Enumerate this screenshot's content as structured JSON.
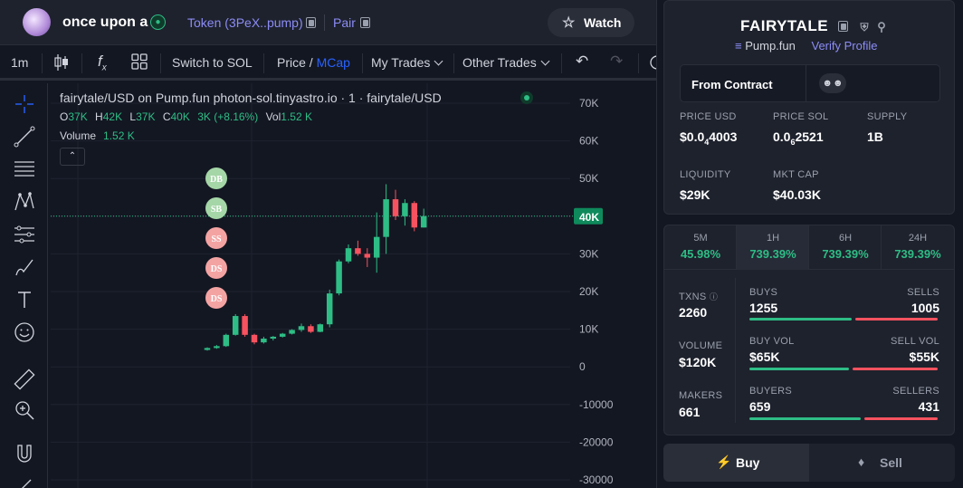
{
  "header": {
    "token_name": "once upon a",
    "token_link": "Token (3PeX..pump)",
    "pair_link": "Pair",
    "watch_label": "Watch"
  },
  "toolbar": {
    "interval": "1m",
    "switch_label": "Switch to SOL",
    "price_label": "Price",
    "slash": "/",
    "mcap_label": "MCap",
    "my_trades": "My Trades",
    "other_trades": "Other Trades"
  },
  "chart": {
    "legend_title": "fairytale/USD on Pump.fun photon-sol.tinyastro.io · 1 · fairytale/USD",
    "ohlc": {
      "o_label": "O",
      "o": "37K",
      "h_label": "H",
      "h": "42K",
      "l_label": "L",
      "l": "37K",
      "c_label": "C",
      "c": "40K",
      "change": "3K (+8.16%)",
      "vol_label": "Vol",
      "vol": "1.52 K"
    },
    "volume_label": "Volume",
    "volume_value": "1.52 K",
    "last_price_tag": "40K",
    "markers": [
      "DB",
      "SB",
      "SS",
      "DS",
      "DS"
    ],
    "y_ticks": [
      "70K",
      "60K",
      "50K",
      "40K",
      "30K",
      "20K",
      "10K",
      "0",
      "-10000",
      "-20000",
      "-30000"
    ]
  },
  "chart_data": {
    "type": "candlestick",
    "series": [
      {
        "name": "fairytale/USD",
        "candles": [
          {
            "o": 4500,
            "h": 5200,
            "l": 4300,
            "c": 5000
          },
          {
            "o": 5000,
            "h": 5800,
            "l": 4800,
            "c": 5500
          },
          {
            "o": 5500,
            "h": 8800,
            "l": 5300,
            "c": 8500
          },
          {
            "o": 8500,
            "h": 14000,
            "l": 8300,
            "c": 13500
          },
          {
            "o": 13500,
            "h": 14000,
            "l": 8000,
            "c": 8500
          },
          {
            "o": 8500,
            "h": 8800,
            "l": 6000,
            "c": 6500
          },
          {
            "o": 6500,
            "h": 8000,
            "l": 6200,
            "c": 7500
          },
          {
            "o": 7500,
            "h": 8200,
            "l": 7000,
            "c": 8000
          },
          {
            "o": 8000,
            "h": 9000,
            "l": 7800,
            "c": 8800
          },
          {
            "o": 8800,
            "h": 10000,
            "l": 8600,
            "c": 9800
          },
          {
            "o": 9800,
            "h": 11500,
            "l": 9300,
            "c": 10800
          },
          {
            "o": 10800,
            "h": 11300,
            "l": 9000,
            "c": 9300
          },
          {
            "o": 9300,
            "h": 11500,
            "l": 9200,
            "c": 11300
          },
          {
            "o": 11300,
            "h": 20500,
            "l": 10500,
            "c": 19500
          },
          {
            "o": 19500,
            "h": 28500,
            "l": 19000,
            "c": 28000
          },
          {
            "o": 28000,
            "h": 32500,
            "l": 27500,
            "c": 31500
          },
          {
            "o": 31500,
            "h": 33500,
            "l": 29500,
            "c": 30000
          },
          {
            "o": 30000,
            "h": 31500,
            "l": 26500,
            "c": 29000
          },
          {
            "o": 29000,
            "h": 41000,
            "l": 25000,
            "c": 34500
          },
          {
            "o": 34500,
            "h": 48500,
            "l": 30000,
            "c": 44500
          },
          {
            "o": 44500,
            "h": 47000,
            "l": 39000,
            "c": 40000
          },
          {
            "o": 40000,
            "h": 44500,
            "l": 37500,
            "c": 43500
          },
          {
            "o": 43500,
            "h": 44000,
            "l": 36000,
            "c": 37000
          },
          {
            "o": 37000,
            "h": 42000,
            "l": 37000,
            "c": 40000
          }
        ]
      }
    ],
    "ylim": [
      -30000,
      70000
    ],
    "grid": true,
    "last_price": 40000
  },
  "panel": {
    "title": "FAIRYTALE",
    "platform": "Pump.fun",
    "verify": "Verify Profile",
    "from_contract": "From Contract",
    "stats": [
      {
        "label": "PRICE USD",
        "main": "$0.0",
        "sub": "4",
        "rest": "4003"
      },
      {
        "label": "PRICE SOL",
        "main": "0.0",
        "sub": "6",
        "rest": "2521"
      },
      {
        "label": "SUPPLY",
        "main": "1B",
        "sub": "",
        "rest": ""
      },
      {
        "label": "LIQUIDITY",
        "main": "$29K",
        "sub": "",
        "rest": ""
      },
      {
        "label": "MKT CAP",
        "main": "$40.03K",
        "sub": "",
        "rest": ""
      }
    ],
    "timeframes": [
      {
        "label": "5M",
        "pct": "45.98%"
      },
      {
        "label": "1H",
        "pct": "739.39%"
      },
      {
        "label": "6H",
        "pct": "739.39%"
      },
      {
        "label": "24H",
        "pct": "739.39%"
      }
    ],
    "txns": {
      "label": "TXNS",
      "value": "2260",
      "buys_label": "BUYS",
      "buys": "1255",
      "sells_label": "SELLS",
      "sells": "1005",
      "buy_ratio": 0.555
    },
    "volume": {
      "label": "VOLUME",
      "value": "$120K",
      "buy_label": "BUY VOL",
      "buy": "$65K",
      "sell_label": "SELL VOL",
      "sell": "$55K",
      "buy_ratio": 0.54
    },
    "makers": {
      "label": "MAKERS",
      "value": "661",
      "buyers_label": "BUYERS",
      "buyers": "659",
      "sellers_label": "SELLERS",
      "sellers": "431",
      "buy_ratio": 0.6
    },
    "buy_tab": "Buy",
    "sell_tab": "Sell"
  },
  "colors": {
    "up": "#2ebd85",
    "down": "#f7525f",
    "accent": "#2962ff",
    "link": "#8c8cf5"
  }
}
